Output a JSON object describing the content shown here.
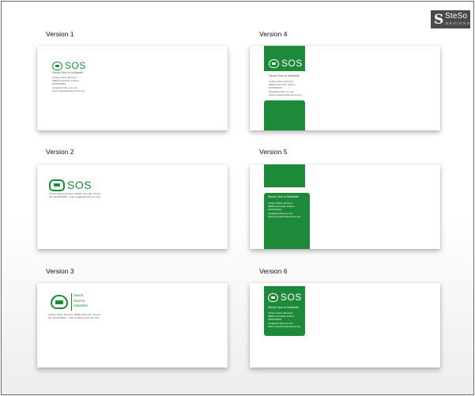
{
  "brand_badge": {
    "mark": "S",
    "name": "SteSo",
    "sub": "DESIGNS"
  },
  "labels": [
    "Version 1",
    "Version 4",
    "Version 2",
    "Version 5",
    "Version 3",
    "Version 6"
  ],
  "logo": {
    "text": "SOS"
  },
  "tagline": "Savoir Oser la Solidarité",
  "tagline_lines": [
    "Savoir",
    "Oser la",
    "Solidarité"
  ],
  "address_lines": [
    "10 Rue Pierre Démord",
    "38000 Grenoble, France",
    "0476752201",
    "sos@grenoble-em.com",
    "www.enseasorteduneirme.org"
  ],
  "address_inline": "10 Rue Pierre Démord, 38000 Grenoble, France",
  "contact_inline": "Tel: 0476752201 · mail: sos@grenoble-em.com",
  "colors": {
    "brand_green": "#1d8a3a",
    "badge": "#4a4a4a"
  }
}
